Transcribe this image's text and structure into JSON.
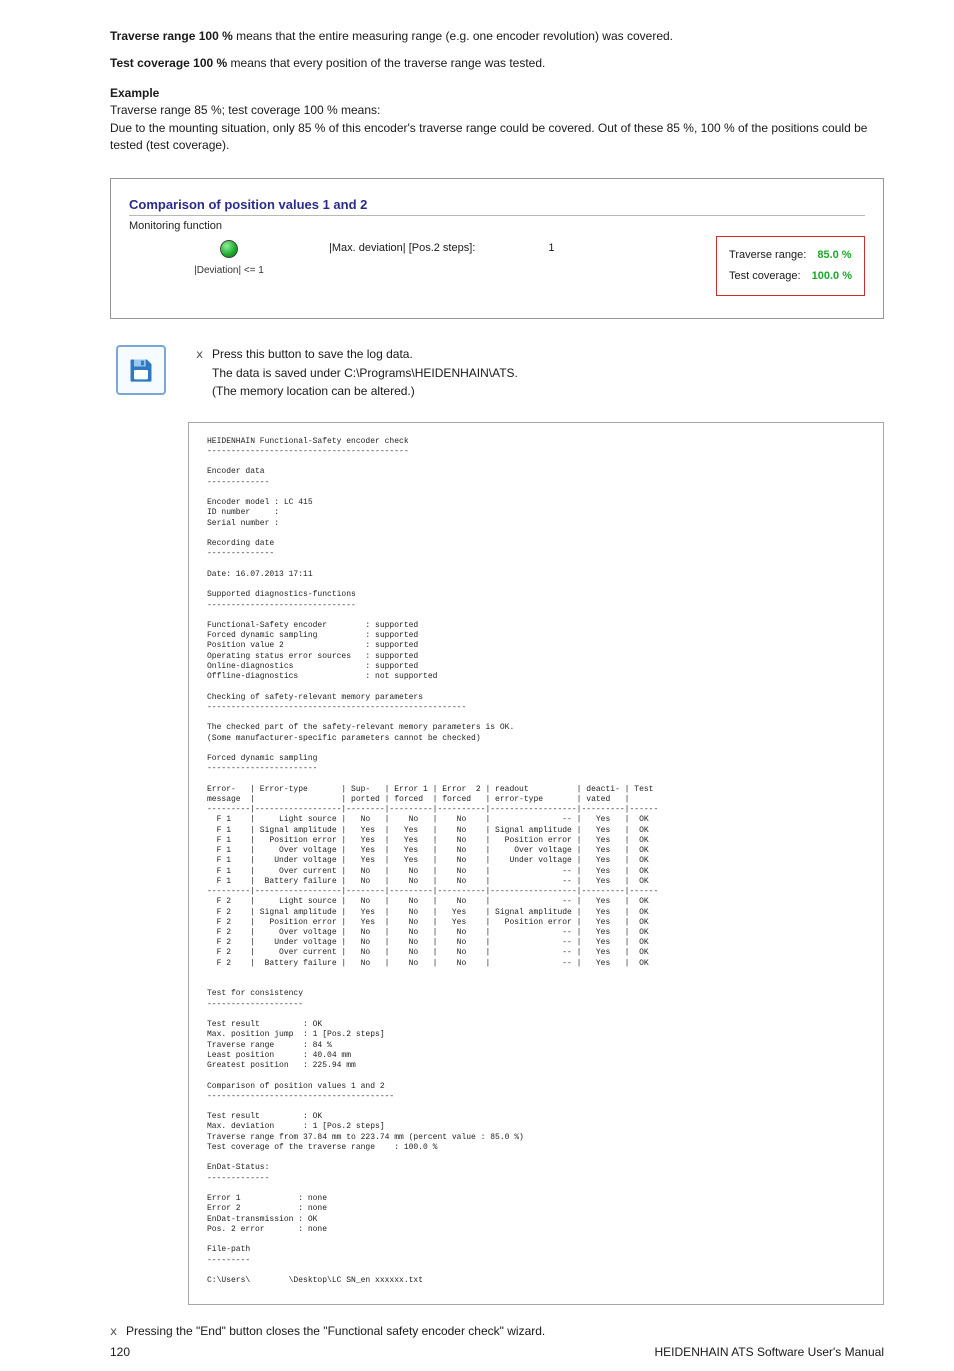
{
  "intro": {
    "p1a": "Traverse range 100 %",
    "p1b": " means that the entire measuring range (e.g. one encoder revolution) was covered.",
    "p2a": "Test coverage 100 %",
    "p2b": " means that every position of the traverse range was tested.",
    "example_title": "Example",
    "example_l1": "Traverse range 85 %; test coverage 100 % means:",
    "example_l2": "Due to the mounting situation, only 85 % of this encoder's traverse range could be covered. Out of these 85 %, 100 % of the positions could be tested (test coverage)."
  },
  "panel": {
    "title": "Comparison of position values 1 and 2",
    "sub": "Monitoring function",
    "led_label": "|Deviation| <= 1",
    "mid_label": "|Max. deviation| [Pos.2 steps]:",
    "mid_value": "1",
    "r1_label": "Traverse range:",
    "r1_value": "85.0 %",
    "r2_label": "Test coverage:",
    "r2_value": "100.0 %"
  },
  "save": {
    "l1": "Press this button to save the log data.",
    "l2": "The data is saved under C:\\Programs\\HEIDENHAIN\\ATS.",
    "l3": "(The memory location can be altered.)"
  },
  "log_text": "HEIDENHAIN Functional-Safety encoder check\n------------------------------------------\n\nEncoder data\n-------------\n\nEncoder model : LC 415\nID number     :\nSerial number :\n\nRecording date\n--------------\n\nDate: 16.07.2013 17:11\n\nSupported diagnostics-functions\n-------------------------------\n\nFunctional-Safety encoder        : supported\nForced dynamic sampling          : supported\nPosition value 2                 : supported\nOperating status error sources   : supported\nOnline-diagnostics               : supported\nOffline-diagnostics              : not supported\n\nChecking of safety-relevant memory parameters\n------------------------------------------------------\n\nThe checked part of the safety-relevant memory parameters is OK.\n(Some manufacturer-specific parameters cannot be checked)\n\nForced dynamic sampling\n-----------------------\n\nError-   | Error-type       | Sup-   | Error 1 | Error  2 | readout          | deacti- | Test\nmessage  |                  | ported | forced  | forced   | error-type       | vated   |\n---------|------------------|--------|---------|----------|------------------|---------|------\n  F 1    |     Light source |   No   |    No   |    No    |               -- |   Yes   |  OK\n  F 1    | Signal amplitude |   Yes  |   Yes   |    No    | Signal amplitude |   Yes   |  OK\n  F 1    |   Position error |   Yes  |   Yes   |    No    |   Position error |   Yes   |  OK\n  F 1    |     Over voltage |   Yes  |   Yes   |    No    |     Over voltage |   Yes   |  OK\n  F 1    |    Under voltage |   Yes  |   Yes   |    No    |    Under voltage |   Yes   |  OK\n  F 1    |     Over current |   No   |    No   |    No    |               -- |   Yes   |  OK\n  F 1    |  Battery failure |   No   |    No   |    No    |               -- |   Yes   |  OK\n---------|------------------|--------|---------|----------|------------------|---------|------\n  F 2    |     Light source |   No   |    No   |    No    |               -- |   Yes   |  OK\n  F 2    | Signal amplitude |   Yes  |    No   |   Yes    | Signal amplitude |   Yes   |  OK\n  F 2    |   Position error |   Yes  |    No   |   Yes    |   Position error |   Yes   |  OK\n  F 2    |     Over voltage |   No   |    No   |    No    |               -- |   Yes   |  OK\n  F 2    |    Under voltage |   No   |    No   |    No    |               -- |   Yes   |  OK\n  F 2    |     Over current |   No   |    No   |    No    |               -- |   Yes   |  OK\n  F 2    |  Battery failure |   No   |    No   |    No    |               -- |   Yes   |  OK\n\n\nTest for consistency\n--------------------\n\nTest result         : OK\nMax. position jump  : 1 [Pos.2 steps]\nTraverse range      : 84 %\nLeast position      : 40.04 mm\nGreatest position   : 225.94 mm\n\nComparison of position values 1 and 2\n---------------------------------------\n\nTest result         : OK\nMax. deviation      : 1 [Pos.2 steps]\nTraverse range from 37.84 mm to 223.74 mm (percent value : 85.0 %)\nTest coverage of the traverse range    : 100.0 %\n\nEnDat-Status:\n-------------\n\nError 1            : none\nError 2            : none\nEnDat-transmission : OK\nPos. 2 error       : none\n\nFile-path\n---------\n\nC:\\Users\\        \\Desktop\\LC SN_en xxxxxx.txt",
  "closing": "Pressing the \"End\" button closes the \"Functional safety encoder check\" wizard.",
  "footer": {
    "page": "120",
    "title": "HEIDENHAIN ATS Software User's Manual"
  }
}
